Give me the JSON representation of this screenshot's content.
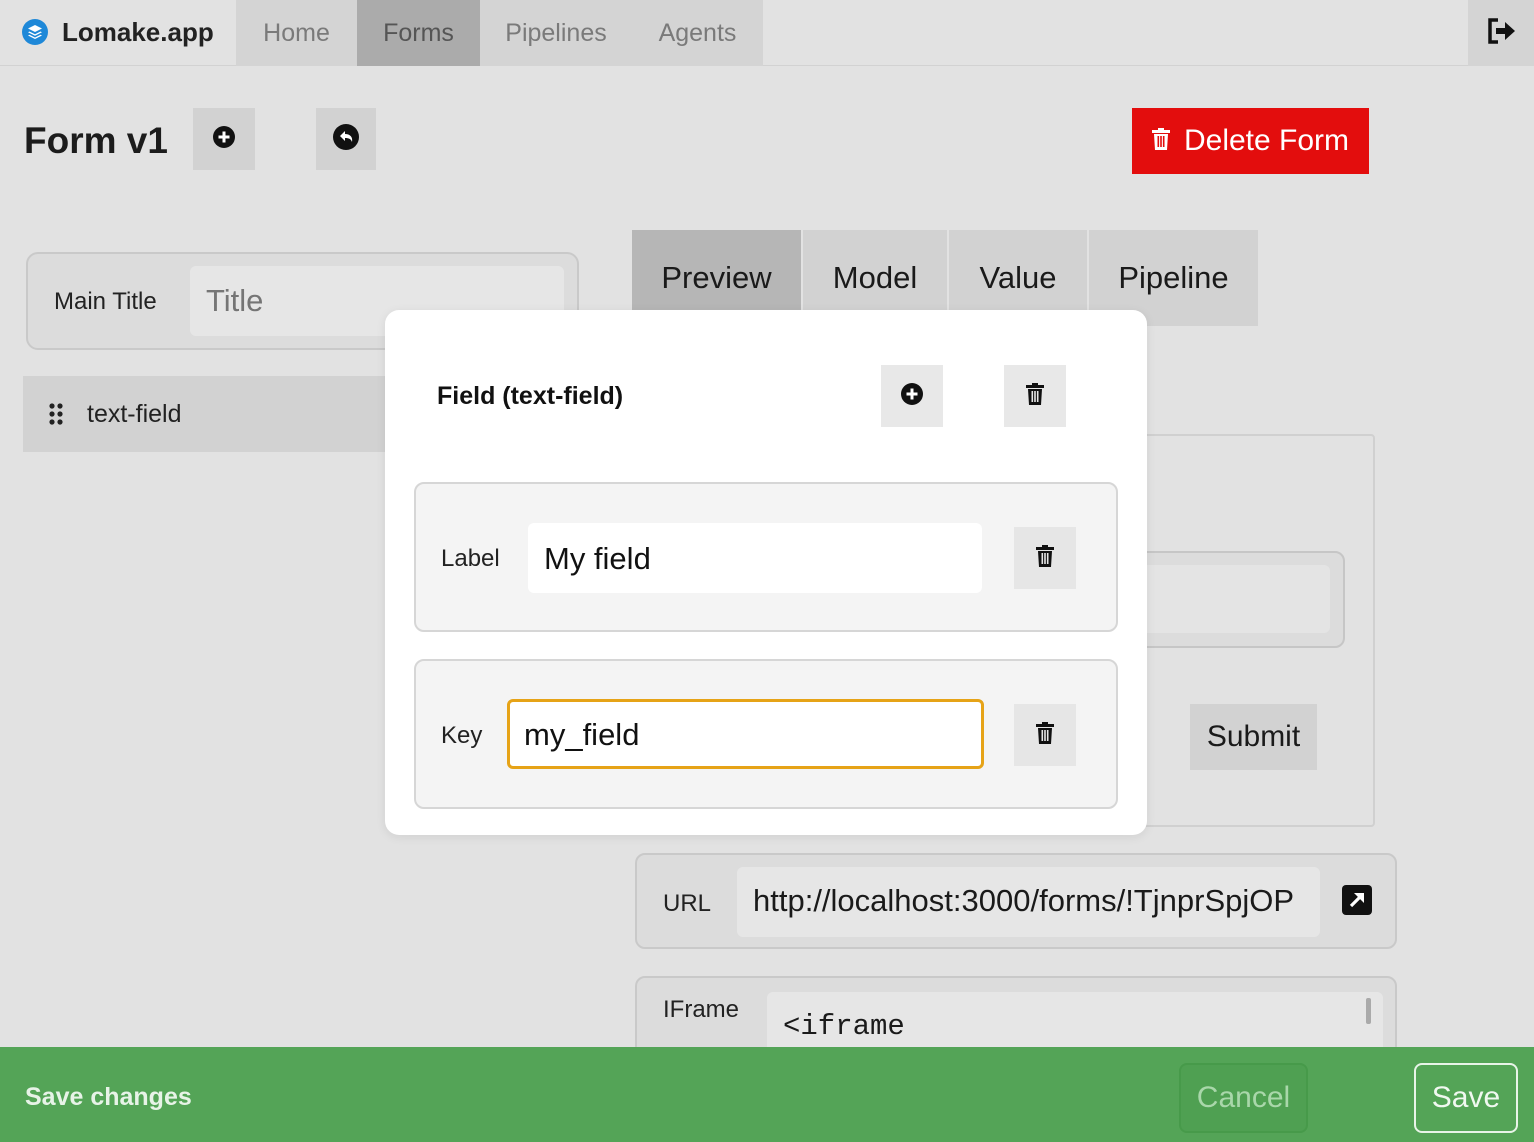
{
  "app": {
    "name": "Lomake.app",
    "brand_icon": "layers-icon",
    "brand_color": "#1e88d8"
  },
  "nav": {
    "tabs": [
      {
        "label": "Home",
        "active": false
      },
      {
        "label": "Forms",
        "active": true
      },
      {
        "label": "Pipelines",
        "active": false
      },
      {
        "label": "Agents",
        "active": false
      }
    ],
    "logout_icon": "sign-out-icon"
  },
  "header": {
    "title": "Form v1",
    "add_icon": "plus-circle-icon",
    "undo_icon": "undo-circle-icon",
    "delete_label": "Delete Form",
    "delete_color": "#e30d0d"
  },
  "left": {
    "main_title_label": "Main Title",
    "main_title_placeholder": "Title",
    "field_item_label": "text-field"
  },
  "right": {
    "tabs": [
      {
        "label": "Preview",
        "active": true
      },
      {
        "label": "Model",
        "active": false
      },
      {
        "label": "Value",
        "active": false
      },
      {
        "label": "Pipeline",
        "active": false
      }
    ],
    "submit_label": "Submit",
    "url_label": "URL",
    "url_value": "http://localhost:3000/forms/!TjnprSpjOP",
    "iframe_label": "IFrame",
    "iframe_code": "<iframe"
  },
  "modal": {
    "title": "Field (text-field)",
    "label_field": {
      "label": "Label",
      "value": "My field"
    },
    "key_field": {
      "label": "Key",
      "value": "my_field"
    },
    "focus_color": "#e6a317"
  },
  "savebar": {
    "text": "Save changes",
    "cancel_label": "Cancel",
    "save_label": "Save",
    "color": "#54a457"
  }
}
